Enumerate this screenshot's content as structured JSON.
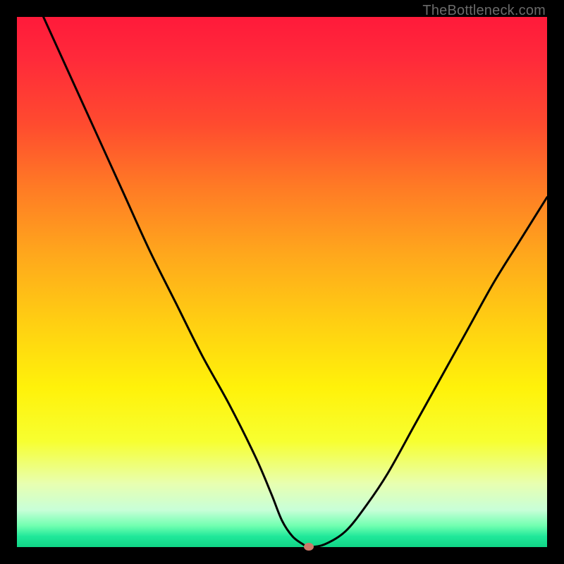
{
  "watermark": "TheBottleneck.com",
  "chart_data": {
    "type": "line",
    "title": "",
    "xlabel": "",
    "ylabel": "",
    "xlim": [
      0,
      100
    ],
    "ylim": [
      0,
      100
    ],
    "grid": false,
    "legend": false,
    "series": [
      {
        "name": "curve",
        "x": [
          5,
          10,
          15,
          20,
          25,
          30,
          35,
          40,
          45,
          48,
          50,
          52,
          54,
          55,
          58,
          62,
          66,
          70,
          75,
          80,
          85,
          90,
          95,
          100
        ],
        "y": [
          100,
          89,
          78,
          67,
          56,
          46,
          36,
          27,
          17,
          10,
          5,
          2,
          0.5,
          0,
          0.5,
          3,
          8,
          14,
          23,
          32,
          41,
          50,
          58,
          66
        ]
      }
    ],
    "marker": {
      "x": 55,
      "y": 0
    },
    "background_gradient": {
      "stops": [
        {
          "pos": 0,
          "color": "#ff1a3a"
        },
        {
          "pos": 20,
          "color": "#ff4a2f"
        },
        {
          "pos": 45,
          "color": "#ffa81c"
        },
        {
          "pos": 70,
          "color": "#fff20a"
        },
        {
          "pos": 93,
          "color": "#c8ffd8"
        },
        {
          "pos": 100,
          "color": "#10d586"
        }
      ]
    }
  }
}
